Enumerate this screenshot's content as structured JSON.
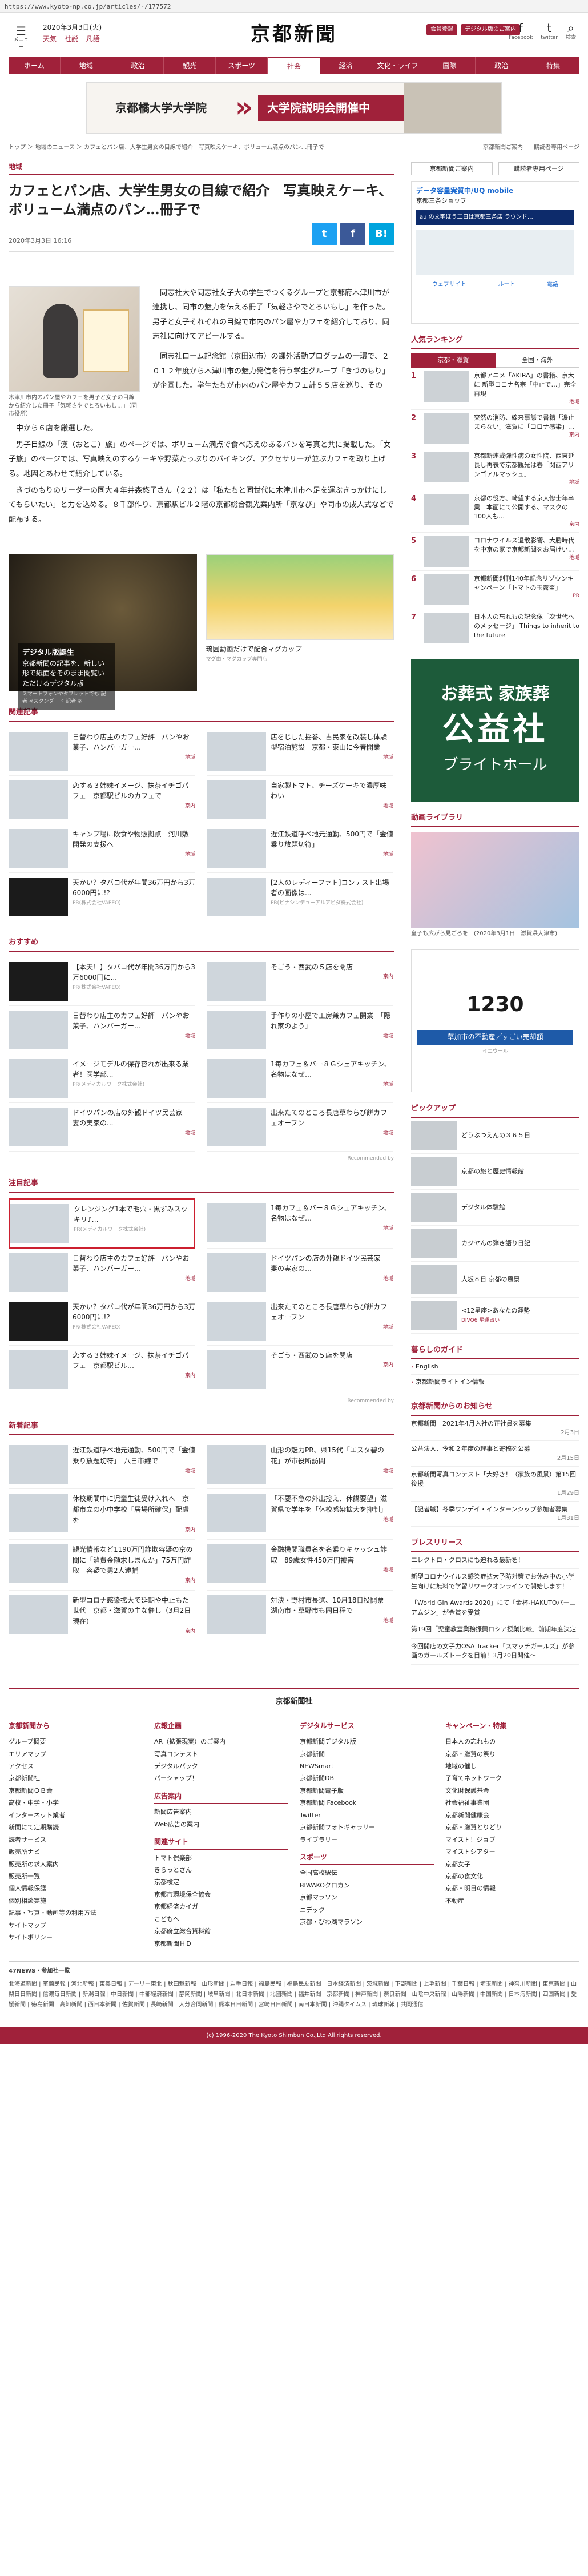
{
  "browser": {
    "url": "https://www.kyoto-np.co.jp/articles/-/177572"
  },
  "header": {
    "menu_label": "メニュー",
    "date": "2020年3月3日(火)",
    "weather": [
      "天気",
      "社説",
      "凡語"
    ],
    "logo": "京都新聞",
    "btn_member": "会員登録",
    "btn_digital": "デジタル版のご案内",
    "social": [
      {
        "icon": "f",
        "label": "Facebook"
      },
      {
        "icon": "t",
        "label": "twitter"
      },
      {
        "icon": "⌕",
        "label": "検索"
      }
    ]
  },
  "nav": [
    "ホーム",
    "地域",
    "政治",
    "観光",
    "スポーツ",
    "社会",
    "経済",
    "文化・ライフ",
    "国際",
    "政治",
    "特集"
  ],
  "banner": {
    "left": "京都橘大学大学院",
    "right": "大学院説明会開催中"
  },
  "breadcrumb": "トップ ＞ 地域のニュース ＞ カフェとパン店、大学生男女の目線で紹介　写真映えケーキ、ボリューム満点のパン…冊子で",
  "crumb_right": [
    "京都新聞ご案内",
    "購読者専用ページ"
  ],
  "article": {
    "category": "地域",
    "title": "カフェとパン店、大学生男女の目線で紹介　写真映えケーキ、ボリューム満点のパン…冊子で",
    "date": "2020年3月3日 16:16",
    "share": [
      "t",
      "f",
      "B!"
    ],
    "caption": "木津川市内のパン屋やカフェを男子と女子の目線から紹介した冊子「気軽さやでとろいもし…」（同市役所）",
    "side_text": [
      "同志社大や同志社女子大の学生でつくるグループと京都府木津川市が連携し、同市の魅力を伝える冊子「気軽さやでとろいもし」を作った。男子と女子それぞれの目線で市内のパン屋やカフェを紹介しており、同志社に向けてアピールする。",
      "同志社ローム記念館（京田辺市）の課外活動プログラムの一環で、２０１２年度から木津川市の魅力発信を行う学生グループ「きづのもり」が企画した。学生たちが市内のパン屋やカフェ計５５店を巡り、その"
    ],
    "full_text": [
      "中から６店を厳選した。",
      "男子目線の「漢（おとこ）旅」のページでは、ボリューム満点で食べ応えのあるパンを写真と共に掲載した。「女子旅」のページでは、写真映えのするケーキや野菜たっぷりのバイキング、アクセサリーが並ぶカフェを取り上げる。地図とあわせて紹介している。",
      "きづのもりのリーダーの同大４年井森悠子さん（２２）は「私たちと同世代に木津川市へ足を運ぶきっかけにしてもらいたい」と力を込める。８千部作り、京都駅ビル２階の京都総合観光案内所「京なび」や同市の成人式などで配布する。"
    ]
  },
  "ads_row": [
    {
      "title": "デジタル版誕生",
      "lines": "京都新聞の記事を、新しい形で紙面をそのまま閲覧いただけるデジタル版",
      "small": "スマートフォンやタブレットでも 記者 ※スタンダード 記者 ※"
    },
    {
      "title": "琉園動画だけで配合マグカップ",
      "sub": "マグ由・マグカップ専門店"
    }
  ],
  "related": {
    "heading": "関連記事",
    "items": [
      {
        "text": "日替わり店主のカフェ好評　パンやお菓子、ハンバーガー…",
        "tag": "地域"
      },
      {
        "text": "店をじした揺巻、古民家を改装し体験型宿泊施設　京都・東山に今春開業",
        "tag": "地域"
      },
      {
        "text": "恋する３姉妹イメージ、抹茶イチゴパフェ　京都駅ビルのカフェで",
        "tag": "京内"
      },
      {
        "text": "自家製トマト、チーズケーキで濃厚味わい",
        "tag": "地域"
      },
      {
        "text": "キャンプ場に飲食や物販拠点　河川敷開発の支援へ",
        "tag": "地域"
      },
      {
        "text": "近江鉄道呼べ地元通勤、500円で「金値乗り放題切符」",
        "tag": "地域"
      },
      {
        "text": "天かい？タバコ代が年間36万円から3万6000円に!?",
        "pr": "PR(株式会社VAPEO)"
      },
      {
        "text": "[2人のレディーファト]コンテスト出場者の画像は...",
        "pr": "PR(ビナシンデューアルアビダ株式会社)"
      }
    ]
  },
  "recommend": {
    "heading": "おすすめ",
    "items": [
      {
        "text": "【本天！】タバコ代が年間36万円から3万6000円に...",
        "pr": "PR(株式会社VAPEO)"
      },
      {
        "text": "そごう・西武の５店を閉店",
        "tag": "京内"
      },
      {
        "text": "日替わり店主のカフェ好評　パンやお菓子、ハンバーガー…",
        "tag": "地域"
      },
      {
        "text": "手作りの小屋で工房兼カフェ開業　「隠れ家のよう」",
        "tag": "地域"
      },
      {
        "text": "イメージモデルの保存容れが出来る業者！医学部...",
        "pr": "PR(メディカルワーク株式会社)"
      },
      {
        "text": "1毎カフェ＆バー８Ｇシェアキッチン、名物はなぜ…",
        "tag": "地域"
      },
      {
        "text": "ドイツパンの店の外観ドイツ民芸家　妻の実家の...",
        "tag": "地域"
      },
      {
        "text": "出来たてのところ長唐草わらび餅カフェオープン",
        "tag": "地域"
      }
    ],
    "footer": "Recommended by"
  },
  "attention": {
    "heading": "注目記事",
    "items": [
      {
        "text": "クレンジング1本で毛穴・黒ずみスッキリ♪…",
        "pr": "PR(メディカルワーク株式会社)",
        "highlight": true
      },
      {
        "text": "1毎カフェ＆バー８Ｇシェアキッチン、名物はなぜ…",
        "tag": "地域"
      },
      {
        "text": "日替わり店主のカフェ好評　パンやお菓子、ハンバーガー…",
        "tag": "地域"
      },
      {
        "text": "ドイツパンの店の外観ドイツ民芸家　妻の実家の…",
        "tag": "地域"
      },
      {
        "text": "天かい？タバコ代が年間36万円から3万6000円に!?",
        "pr": "PR(株式会社VAPEO)"
      },
      {
        "text": "出来たてのところ長唐草わらび餅カフェオープン",
        "tag": "地域"
      },
      {
        "text": "恋する３姉妹イメージ、抹茶イチゴパフェ　京都駅ビル…",
        "tag": "京内"
      },
      {
        "text": "そごう・西武の５店を閉店",
        "tag": "京内"
      }
    ],
    "footer": "Recommended by"
  },
  "latest": {
    "heading": "新着記事",
    "items": [
      {
        "text": "近江鉄道呼べ地元通勤、500円で「金値乗り放題切符」　八日市線で",
        "tag": "地域"
      },
      {
        "text": "山形の魅力PR、県15代「エスタ碧の花」が市役所訪問",
        "tag": "地域"
      },
      {
        "text": "休校期間中に児童生徒受け入れへ　京都市立の小中学校「居場所確保」配慮を",
        "tag": "京内"
      },
      {
        "text": "「不要不急の外出控え、休講要望」滋賀県で学年を「休校感染拡大を抑制」",
        "tag": "地域"
      },
      {
        "text": "観光情報など1190万円詐欺容疑の京の間に「消費金額求しまんか」75万円詐取　容疑で男2人逮捕",
        "tag": "京内"
      },
      {
        "text": "金融機関職員名を名乗りキャッシュ詐取　89歳女性450万円被害",
        "tag": "地域"
      },
      {
        "text": "新型コロナ感染拡大で延期や中止もた世代　京都・滋賀の主な催し（3月2日現在）",
        "tag": "京内"
      },
      {
        "text": "対決・野村市長選、10月18日投開票　湖南市・草野市も同日程で",
        "tag": "地域"
      }
    ]
  },
  "sidebar": {
    "links": [
      "京都新聞ご案内",
      "購読者専用ページ"
    ],
    "ad_uq": {
      "title": "データ容量実質中/UQ mobile",
      "sub": "京都三条ショップ",
      "bar": "au の文字ほう工日は京都三条店 ラウンド…",
      "acts": [
        "ウェブサイト",
        "ルート",
        "電話"
      ]
    },
    "ranking_heading": "人気ランキング",
    "ranking_tabs": [
      "京都・滋賀",
      "全国・海外"
    ],
    "ranking": [
      {
        "no": "1",
        "text": "京都アニメ「AKIRA」の書籍、京大に 新型コロナ名宗「中止で…」完全再現",
        "tag": "地域"
      },
      {
        "text": "突然の消防、線来事態で書籍「涙止まらない」滋賀に「コロナ感染」…",
        "tag": "京内",
        "no": "2"
      },
      {
        "text": "京都新連載弾性病の女性院、西東延長し再表で京都観光は春「関西アリンゴアルマッシュ」",
        "tag": "地域",
        "no": "3"
      },
      {
        "text": "京都の役方、崎望する京大修士年卒業　本面にて公開する、マスクの100人も…",
        "tag": "京内",
        "no": "4"
      },
      {
        "text": "コロナウイルス退散影響、大勝時代を中京の家で京都新聞をお届けい...",
        "tag": "地域",
        "no": "5"
      },
      {
        "text": "京都新聞創刊140年記念リゾウンキャンペーン「トマトの玉露盃」",
        "tag": "PR",
        "no": "6"
      },
      {
        "text": "日本人の忘れもの記念像「次世代へのメッセージ」 Things to inherit to the future",
        "no": "7"
      }
    ],
    "funeral": {
      "a": "お葬式 家族葬",
      "b": "公益社",
      "c": "ブライトホール"
    },
    "video_heading": "動画ライブラリ",
    "video_caption": "皇子も広がら見ごろを　(2020年3月1日　滋賀県大津市)",
    "ad_realestate": {
      "big": "1230",
      "sub": "草加市の不動産／すごい売却額",
      "note": "イエウール"
    },
    "pickup_heading": "ピックアップ",
    "pickup": [
      {
        "text": "どうぶつえんの３６５日"
      },
      {
        "text": "京都の旅と歴史情報館"
      },
      {
        "text": "デジタル体験館"
      },
      {
        "text": "カジヤんの弾き語り日記"
      },
      {
        "text": "大坂８日 京都の風景"
      },
      {
        "text": "<12星座>あなたの運勢",
        "tag": "DIVO6 星運占い"
      }
    ],
    "guide_heading": "暮らしのガイド",
    "guide": [
      "English",
      "京都新聞ライトイン情報"
    ],
    "notice_heading": "京都新聞からのお知らせ",
    "notice": [
      {
        "text": "京都新聞　2021年4月入社の正社員を募集",
        "d": "2月3日"
      },
      {
        "text": "公益法人、令和２年度の理事と寄稿を公募",
        "d": "2月15日"
      },
      {
        "text": "京都新聞写真コンテスト「大好き！（家族の風景）第15回後援",
        "d": "1月29日"
      },
      {
        "text": "【記者職】冬季ワンデイ・インターンシップ参加者募集",
        "d": "1月31日"
      }
    ],
    "press_heading": "プレスリリース",
    "press": [
      "エレクトロ・クロスにも迫れる最新を！",
      "新型コロナウイルス感染症拡大予防対策でお休み中の小学生向けに無料で学習リワークオンラインで開始します！",
      "「World Gin Awards 2020」にて「金杯-HAKUTOバーニアムジン」が金賞を受賞",
      "第19回「児童教室業務振興ロシア授業比較」前期年度決定",
      "今回開店の女子力OSA Tracker「スマッチガールズ」が参画のガールズトークを目前！3月20日開催～"
    ]
  },
  "footer": {
    "brand": "京都新聞社",
    "cols": [
      {
        "h": "京都新聞から",
        "items": [
          "グループ概要",
          "エリアマップ",
          "アクセス",
          "京都新聞社",
          "京都新聞ＯＢ会",
          "高校・中学・小学",
          "インターネット業者",
          "新聞にて定期購読",
          "読者サービス",
          "販売所ナビ",
          "販売所の求人案内",
          "販売所一覧",
          "個人情報保護",
          "個別相談実施",
          "記事・写真・動画等の利用方法",
          "サイトマップ",
          "サイトポリシー"
        ]
      },
      {
        "h": "広報企画",
        "items": [
          "AR（拡張現実）のご案内",
          "写真コンテスト",
          "デジタルパック",
          "パーシャップ！"
        ],
        "h2": "広告案内",
        "items2": [
          "新聞広告案内",
          "Web広告の案内"
        ],
        "h3": "関連サイト",
        "items3": [
          "トマト倶楽部",
          "きらっとさん",
          "京都検定",
          "京都市環境保全協会",
          "京都経済カイガ",
          "こどもへ",
          "京都府立総合資料館",
          "京都新聞ＨＤ"
        ]
      },
      {
        "h": "デジタルサービス",
        "items": [
          "京都新聞デジタル版",
          "京都新聞",
          "NEWSmart",
          "京都新聞DB",
          "京都新聞電子版",
          "京都新聞 Facebook",
          "Twitter",
          "京都新聞フォトギャラリー",
          "ライブラリー"
        ],
        "h2": "スポーツ",
        "items2": [
          "全国高校駅伝",
          "BIWAKOクロカン",
          "京都マラソン",
          "ニデック",
          "京都・びわ湖マラソン"
        ]
      },
      {
        "h": "キャンペーン・特集",
        "items": [
          "日本人の忘れもの",
          "京都・滋賀の祭り",
          "地域の催し",
          "子育てネットワーク",
          "文化財保護基金",
          "社会福祉事業団",
          "京都新聞健康会",
          "京都・滋賀とりどり",
          "マイスト！ジョブ",
          "マイストシアター",
          "京都女子",
          "京都の食文化",
          "京都・明日の情報",
          "不動産"
        ]
      }
    ],
    "news47_heading": "47NEWS・参加社一覧",
    "news47_list": "北海道新聞 | 室蘭民報 | 河北新報 | 東奥日報 | デーリー東北 | 秋田魁新報 | 山形新聞 | 岩手日報 | 福島民報 | 福島民友新聞 | 日本経済新聞 | 茨城新聞 | 下野新聞 | 上毛新聞 | 千葉日報 | 埼玉新聞 | 神奈川新聞 | 東京新聞 | 山梨日日新聞 | 信濃毎日新聞 | 新潟日報 | 中日新聞 | 中部経済新聞 | 静岡新聞 | 岐阜新聞 | 北日本新聞 | 北國新聞 | 福井新聞 | 京都新聞 | 神戸新聞 | 奈良新聞 | 山陰中央新報 | 山陽新聞 | 中国新聞 | 日本海新聞 | 四国新聞 | 愛媛新聞 | 徳島新聞 | 高知新聞 | 西日本新聞 | 佐賀新聞 | 長崎新聞 | 大分合同新聞 | 熊本日日新聞 | 宮崎日日新聞 | 南日本新聞 | 沖縄タイムス | 琉球新報 | 共同通信",
    "copyright": "(c) 1996-2020 The Kyoto Shimbun Co.,Ltd All rights reserved."
  }
}
